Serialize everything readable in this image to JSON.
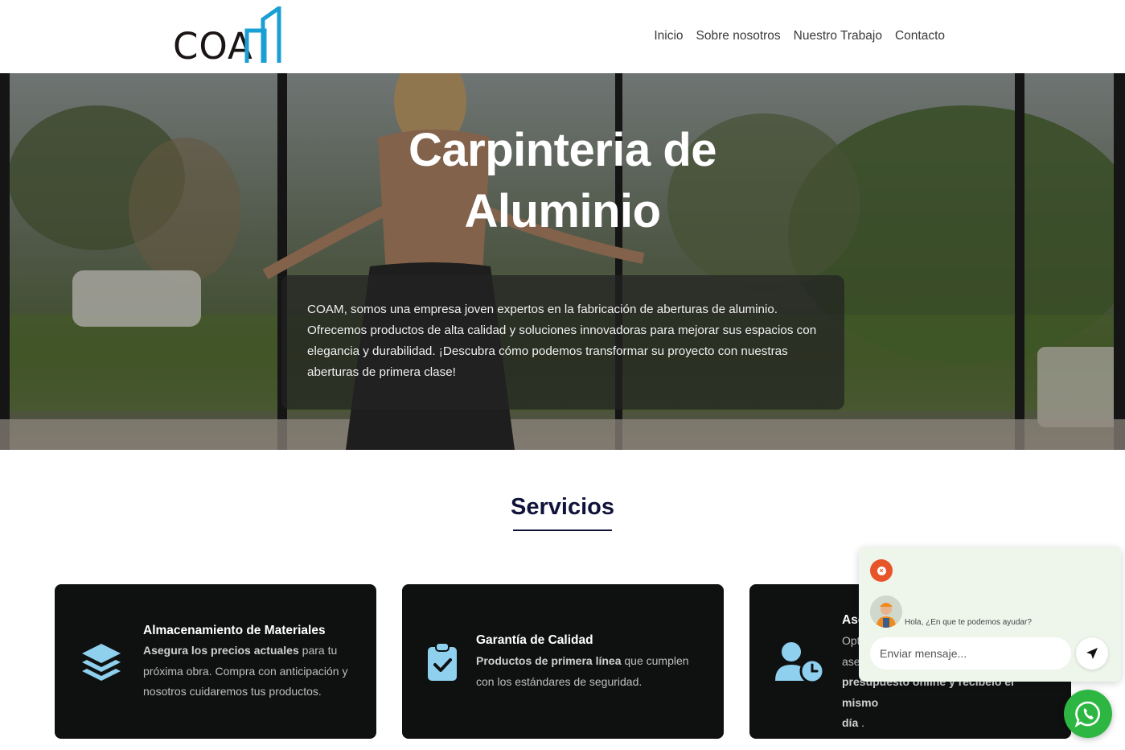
{
  "header": {
    "logo_text": "COA",
    "nav": [
      "Inicio",
      "Sobre nosotros",
      "Nuestro Trabajo",
      "Contacto"
    ]
  },
  "hero": {
    "title_line1": "Carpinteria de",
    "title_line2": "Aluminio",
    "description": "COAM, somos una empresa joven expertos en la fabricación de aberturas de aluminio. Ofrecemos productos de alta calidad y soluciones innovadoras para mejorar sus espacios con elegancia y durabilidad. ¡Descubra cómo podemos transformar su proyecto con nuestras aberturas de primera clase!"
  },
  "services": {
    "title": "Servicios",
    "cards": [
      {
        "title": "Almacenamiento de Materiales",
        "strong": "Asegura los precios actuales",
        "text": " para tu próxima obra. Compra con anticipación y nosotros cuidaremos tus productos.",
        "icon": "layers-icon"
      },
      {
        "title": "Garantía de Calidad",
        "strong": "Productos de primera línea",
        "text": " que cumplen con los estándares de seguridad.",
        "icon": "clipboard-check-icon"
      },
      {
        "title": "Ase",
        "text_line1": "Opt",
        "text_line2": "ase",
        "strong_line3": "presupuesto online y recibelo el mismo",
        "strong_line4": "día",
        "text_line4": " .",
        "icon": "user-clock-icon"
      }
    ]
  },
  "chat": {
    "greeting": "Hola, ¿En que te podemos ayudar?",
    "placeholder": "Enviar mensaje..."
  },
  "colors": {
    "accent_blue": "#1a9fd4",
    "dark_navy": "#10123a",
    "card_bg": "#0f1111",
    "icon_blue": "#8fd0ef",
    "whatsapp_green": "#2db742",
    "close_orange": "#e8542a"
  }
}
